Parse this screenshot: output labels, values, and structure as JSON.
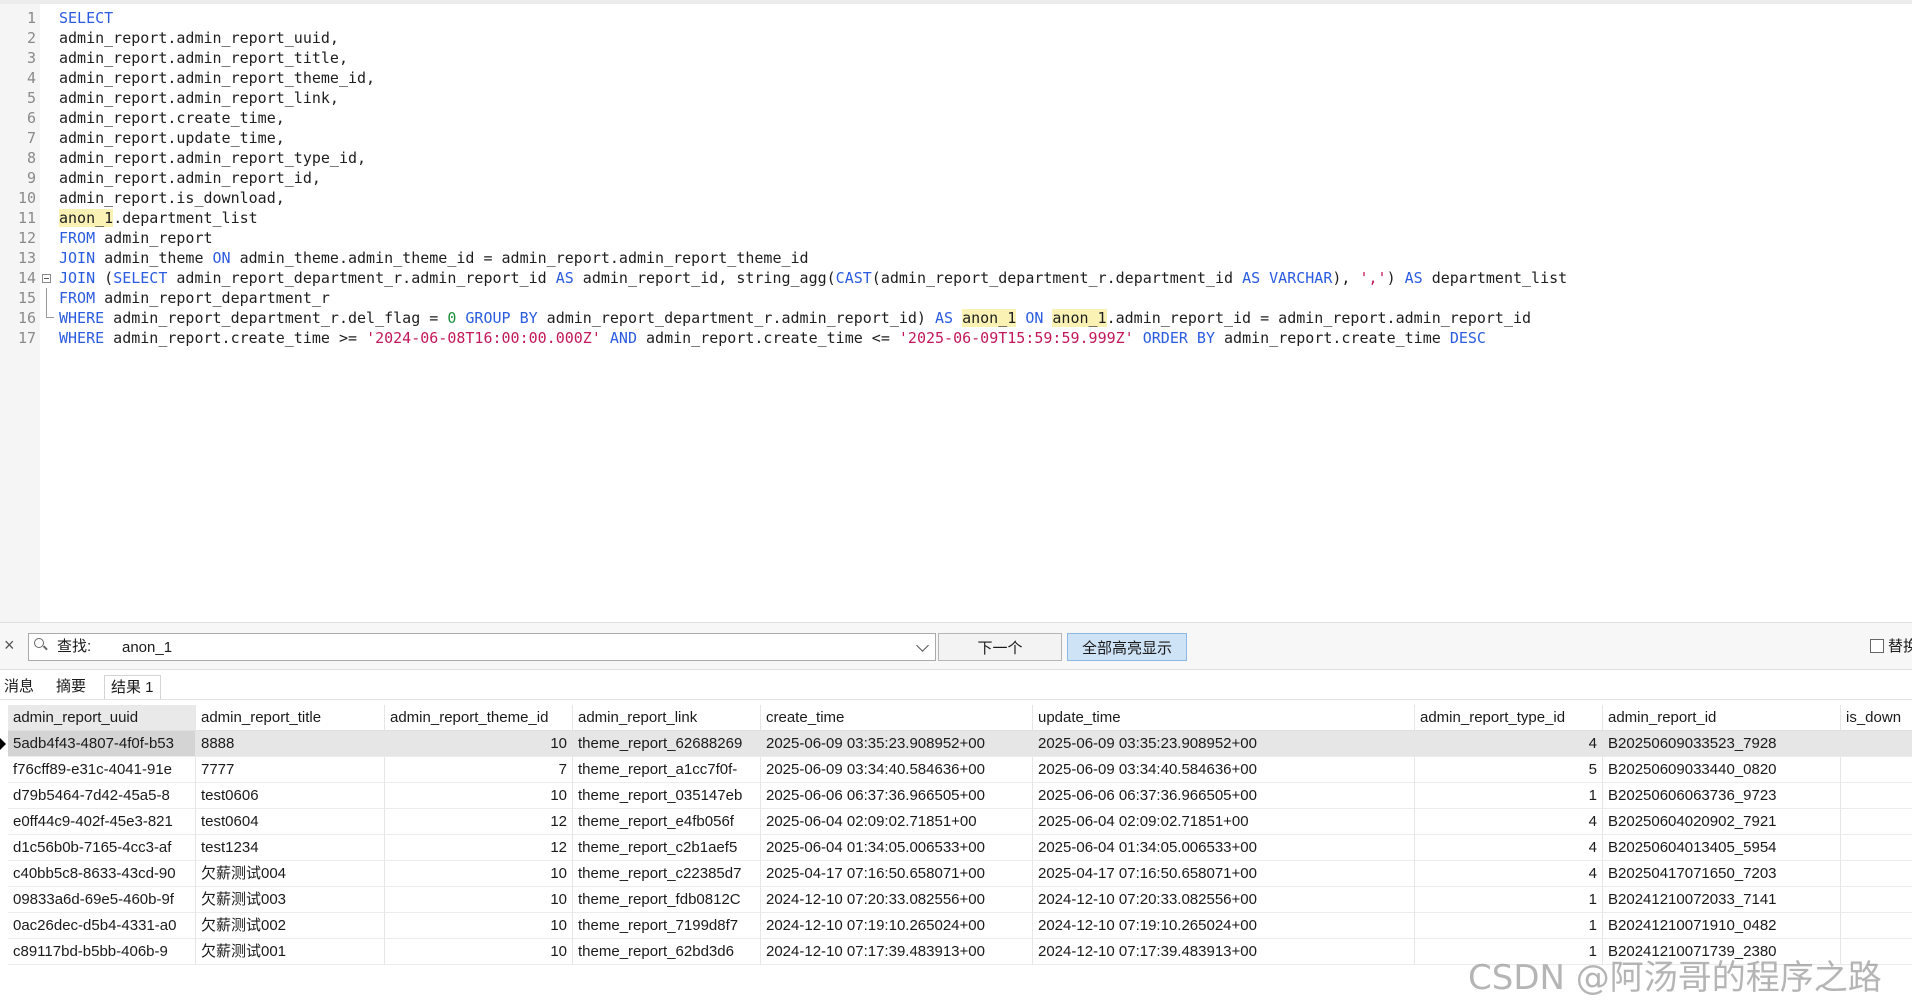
{
  "editor": {
    "lines": [
      {
        "n": "1",
        "segs": [
          {
            "t": "SELECT",
            "c": "kw"
          }
        ]
      },
      {
        "n": "2",
        "segs": [
          {
            "t": "admin_report.admin_report_uuid,"
          }
        ]
      },
      {
        "n": "3",
        "segs": [
          {
            "t": "admin_report.admin_report_title,"
          }
        ]
      },
      {
        "n": "4",
        "segs": [
          {
            "t": "admin_report.admin_report_theme_id,"
          }
        ]
      },
      {
        "n": "5",
        "segs": [
          {
            "t": "admin_report.admin_report_link,"
          }
        ]
      },
      {
        "n": "6",
        "segs": [
          {
            "t": "admin_report.create_time,"
          }
        ]
      },
      {
        "n": "7",
        "segs": [
          {
            "t": "admin_report.update_time,"
          }
        ]
      },
      {
        "n": "8",
        "segs": [
          {
            "t": "admin_report.admin_report_type_id,"
          }
        ]
      },
      {
        "n": "9",
        "segs": [
          {
            "t": "admin_report.admin_report_id,"
          }
        ]
      },
      {
        "n": "10",
        "segs": [
          {
            "t": "admin_report.is_download,"
          }
        ]
      },
      {
        "n": "11",
        "segs": [
          {
            "t": "anon_1",
            "c": "hl"
          },
          {
            "t": ".department_list"
          }
        ]
      },
      {
        "n": "12",
        "segs": [
          {
            "t": "FROM",
            "c": "kw"
          },
          {
            "t": " admin_report"
          }
        ]
      },
      {
        "n": "13",
        "segs": [
          {
            "t": "JOIN",
            "c": "kw"
          },
          {
            "t": " admin_theme "
          },
          {
            "t": "ON",
            "c": "kw"
          },
          {
            "t": " admin_theme.admin_theme_id = admin_report.admin_report_theme_id"
          }
        ]
      },
      {
        "n": "14",
        "segs": [
          {
            "t": "JOIN",
            "c": "kw"
          },
          {
            "t": " ("
          },
          {
            "t": "SELECT",
            "c": "kw"
          },
          {
            "t": " admin_report_department_r.admin_report_id "
          },
          {
            "t": "AS",
            "c": "kw"
          },
          {
            "t": " admin_report_id, string_agg("
          },
          {
            "t": "CAST",
            "c": "kw"
          },
          {
            "t": "(admin_report_department_r.department_id "
          },
          {
            "t": "AS",
            "c": "kw"
          },
          {
            "t": " "
          },
          {
            "t": "VARCHAR",
            "c": "kw"
          },
          {
            "t": "), "
          },
          {
            "t": "','",
            "c": "str"
          },
          {
            "t": ") "
          },
          {
            "t": "AS",
            "c": "kw"
          },
          {
            "t": " department_list"
          }
        ]
      },
      {
        "n": "15",
        "segs": [
          {
            "t": "FROM",
            "c": "kw"
          },
          {
            "t": " admin_report_department_r"
          }
        ]
      },
      {
        "n": "16",
        "segs": [
          {
            "t": "WHERE",
            "c": "kw"
          },
          {
            "t": " admin_report_department_r.del_flag = "
          },
          {
            "t": "0",
            "c": "num"
          },
          {
            "t": " "
          },
          {
            "t": "GROUP BY",
            "c": "kw"
          },
          {
            "t": " admin_report_department_r.admin_report_id) "
          },
          {
            "t": "AS",
            "c": "kw"
          },
          {
            "t": " "
          },
          {
            "t": "anon_1",
            "c": "hl"
          },
          {
            "t": " "
          },
          {
            "t": "ON",
            "c": "kw"
          },
          {
            "t": " "
          },
          {
            "t": "anon_1",
            "c": "hl"
          },
          {
            "t": ".admin_report_id = admin_report.admin_report_id"
          }
        ]
      },
      {
        "n": "17",
        "segs": [
          {
            "t": "WHERE",
            "c": "kw"
          },
          {
            "t": " admin_report.create_time >= "
          },
          {
            "t": "'2024-06-08T16:00:00.000Z'",
            "c": "str"
          },
          {
            "t": " "
          },
          {
            "t": "AND",
            "c": "kw"
          },
          {
            "t": " admin_report.create_time <= "
          },
          {
            "t": "'2025-06-09T15:59:59.999Z'",
            "c": "str"
          },
          {
            "t": " "
          },
          {
            "t": "ORDER BY",
            "c": "kw"
          },
          {
            "t": " admin_report.create_time "
          },
          {
            "t": "DESC",
            "c": "kw"
          }
        ]
      }
    ]
  },
  "find": {
    "label": "查找:",
    "value": "anon_1",
    "next_label": "下一个",
    "highlight_all_label": "全部高亮显示",
    "replace_label": "替换"
  },
  "tabs": [
    {
      "label": "消息"
    },
    {
      "label": "摘要"
    },
    {
      "label": "结果 1"
    }
  ],
  "results": {
    "columns": [
      "admin_report_uuid",
      "admin_report_title",
      "admin_report_theme_id",
      "admin_report_link",
      "create_time",
      "update_time",
      "admin_report_type_id",
      "admin_report_id",
      "is_down"
    ],
    "rows": [
      [
        "5adb4f43-4807-4f0f-b53",
        "8888",
        "10",
        "theme_report_62688269",
        "2025-06-09 03:35:23.908952+00",
        "2025-06-09 03:35:23.908952+00",
        "4",
        "B20250609033523_7928",
        ""
      ],
      [
        "f76cff89-e31c-4041-91e",
        "7777",
        "7",
        "theme_report_a1cc7f0f-",
        "2025-06-09 03:34:40.584636+00",
        "2025-06-09 03:34:40.584636+00",
        "5",
        "B20250609033440_0820",
        ""
      ],
      [
        "d79b5464-7d42-45a5-8",
        "test0606",
        "10",
        "theme_report_035147eb",
        "2025-06-06 06:37:36.966505+00",
        "2025-06-06 06:37:36.966505+00",
        "1",
        "B20250606063736_9723",
        ""
      ],
      [
        "e0ff44c9-402f-45e3-821",
        "test0604",
        "12",
        "theme_report_e4fb056f",
        "2025-06-04 02:09:02.71851+00",
        "2025-06-04 02:09:02.71851+00",
        "4",
        "B20250604020902_7921",
        ""
      ],
      [
        "d1c56b0b-7165-4cc3-af",
        "test1234",
        "12",
        "theme_report_c2b1aef5",
        "2025-06-04 01:34:05.006533+00",
        "2025-06-04 01:34:05.006533+00",
        "4",
        "B20250604013405_5954",
        ""
      ],
      [
        "c40bb5c8-8633-43cd-90",
        "欠薪测试004",
        "10",
        "theme_report_c22385d7",
        "2025-04-17 07:16:50.658071+00",
        "2025-04-17 07:16:50.658071+00",
        "4",
        "B20250417071650_7203",
        ""
      ],
      [
        "09833a6d-69e5-460b-9f",
        "欠薪测试003",
        "10",
        "theme_report_fdb0812C",
        "2024-12-10 07:20:33.082556+00",
        "2024-12-10 07:20:33.082556+00",
        "1",
        "B20241210072033_7141",
        ""
      ],
      [
        "0ac26dec-d5b4-4331-a0",
        "欠薪测试002",
        "10",
        "theme_report_7199d8f7",
        "2024-12-10 07:19:10.265024+00",
        "2024-12-10 07:19:10.265024+00",
        "1",
        "B20241210071910_0482",
        ""
      ],
      [
        "c89117bd-b5bb-406b-9",
        "欠薪测试001",
        "10",
        "theme_report_62bd3d6",
        "2024-12-10 07:17:39.483913+00",
        "2024-12-10 07:17:39.483913+00",
        "1",
        "B20241210071739_2380",
        ""
      ]
    ]
  },
  "watermark": "CSDN @阿汤哥的程序之路"
}
